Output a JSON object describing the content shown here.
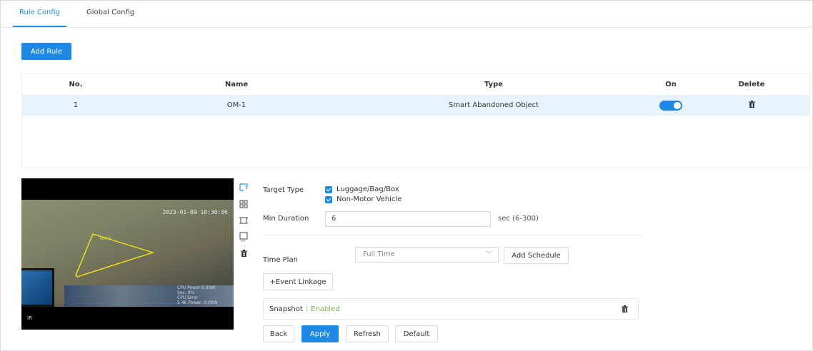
{
  "tabs": [
    {
      "label": "Rule Config",
      "active": true
    },
    {
      "label": "Global Config",
      "active": false
    }
  ],
  "add_rule_label": "Add Rule",
  "table": {
    "headers": [
      "No.",
      "Name",
      "Type",
      "On",
      "Delete"
    ],
    "rows": [
      {
        "no": "1",
        "name": "OM-1",
        "type": "Smart Abandoned Object",
        "on": true
      }
    ]
  },
  "video": {
    "timestamp": "2023-01-09 10:30:06",
    "region_label": "OM-1",
    "osd_lines": [
      "CPU Power:0.00W",
      "Sec: 0%",
      "CPU Error",
      "5.46 Power: 0.00W"
    ],
    "corner_label": "IR"
  },
  "form": {
    "target_type_label": "Target Type",
    "target_options": [
      "Luggage/Bag/Box",
      "Non-Motor Vehicle"
    ],
    "min_duration_label": "Min Duration",
    "min_duration_value": "6",
    "min_duration_unit": "sec (6-300)",
    "time_plan_label": "Time Plan",
    "time_plan_value": "Full Time",
    "add_schedule_label": "Add Schedule",
    "event_linkage_label": "+Event Linkage",
    "snapshot_label": "Snapshot",
    "snapshot_sep": "|",
    "snapshot_status": "Enabled"
  },
  "actions": {
    "back": "Back",
    "apply": "Apply",
    "refresh": "Refresh",
    "default": "Default"
  },
  "colors": {
    "accent": "#1e88e5",
    "row_highlight": "#e8f3fd",
    "enabled_text": "#7cb342",
    "rule_polygon": "#f2e61a"
  },
  "icons": [
    "draw-rule-icon",
    "detection-area-icon",
    "target-filter-icon",
    "max-size-icon",
    "trash-icon"
  ]
}
